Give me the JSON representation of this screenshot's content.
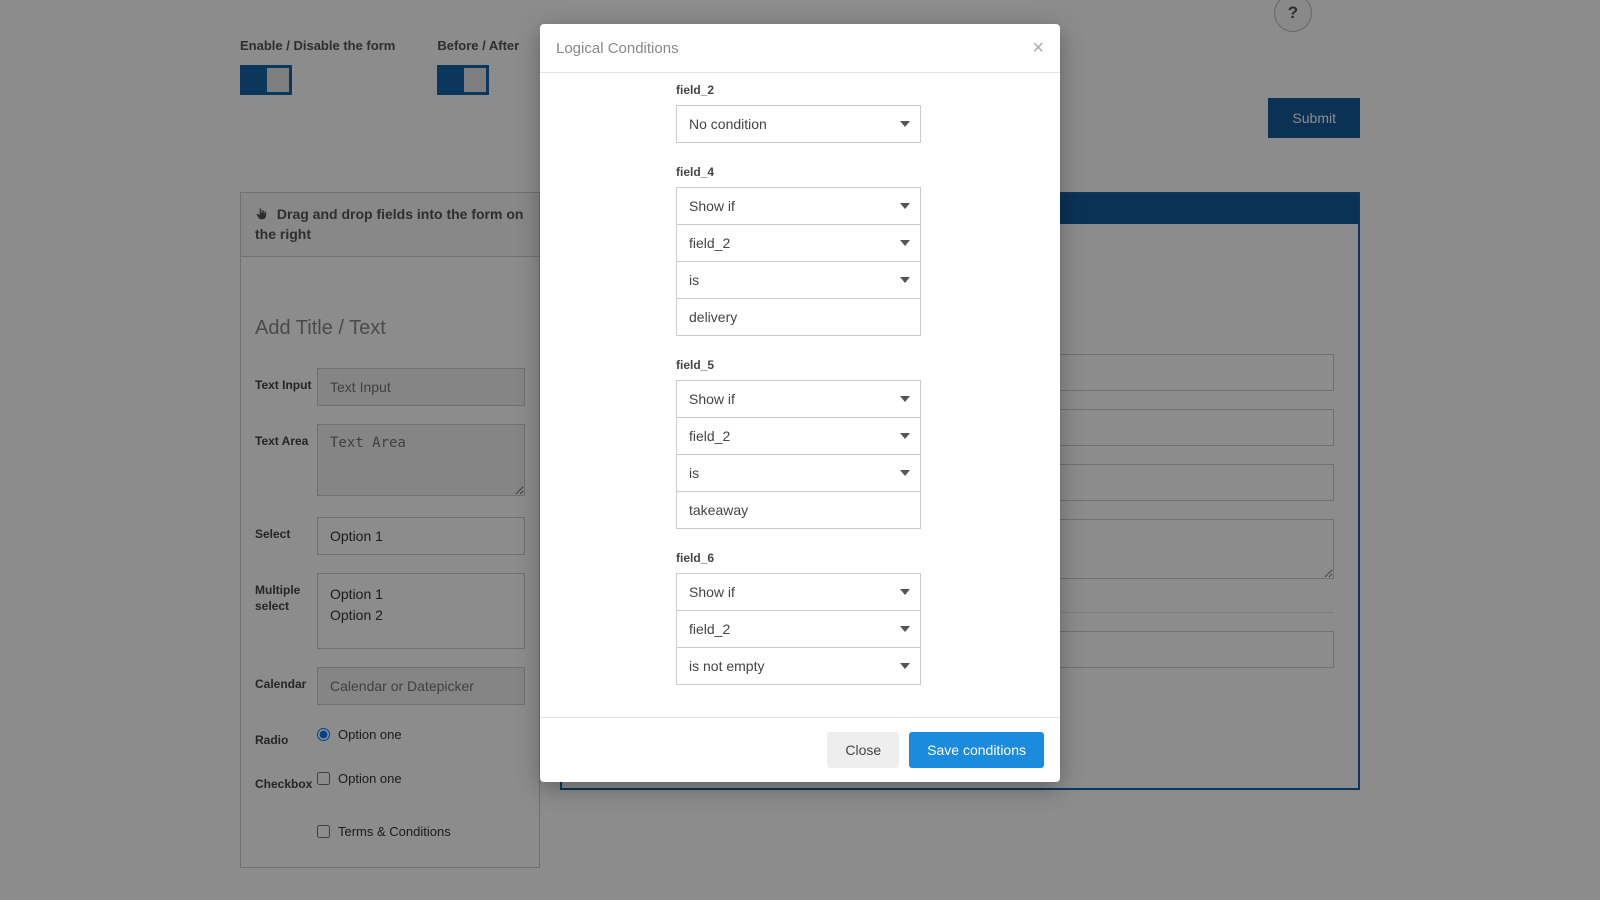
{
  "help_icon": "?",
  "top": {
    "enable_label": "Enable / Disable the form",
    "before_after_label": "Before / After",
    "submit_label": "Submit"
  },
  "left": {
    "hint": "Drag and drop fields into the form on the right",
    "add_title": "Add Title / Text",
    "fields": {
      "text_input": {
        "label": "Text Input",
        "placeholder": "Text Input"
      },
      "text_area": {
        "label": "Text Area",
        "placeholder": "Text Area"
      },
      "select": {
        "label": "Select",
        "value": "Option 1"
      },
      "multi": {
        "label": "Multiple select",
        "opt1": "Option 1",
        "opt2": "Option 2"
      },
      "calendar": {
        "label": "Calendar",
        "placeholder": "Calendar or Datepicker"
      },
      "radio": {
        "label": "Radio",
        "opt": "Option one"
      },
      "checkbox": {
        "label": "Checkbox",
        "opt": "Option one"
      },
      "terms": "Terms & Conditions"
    }
  },
  "modal": {
    "title": "Logical Conditions",
    "close_label": "Close",
    "save_label": "Save conditions",
    "groups": [
      {
        "field": "field_2",
        "selects": [
          "No condition"
        ],
        "input": null
      },
      {
        "field": "field_4",
        "selects": [
          "Show if",
          "field_2",
          "is"
        ],
        "input": "delivery"
      },
      {
        "field": "field_5",
        "selects": [
          "Show if",
          "field_2",
          "is"
        ],
        "input": "takeaway"
      },
      {
        "field": "field_6",
        "selects": [
          "Show if",
          "field_2",
          "is not empty"
        ],
        "input": null
      }
    ]
  }
}
